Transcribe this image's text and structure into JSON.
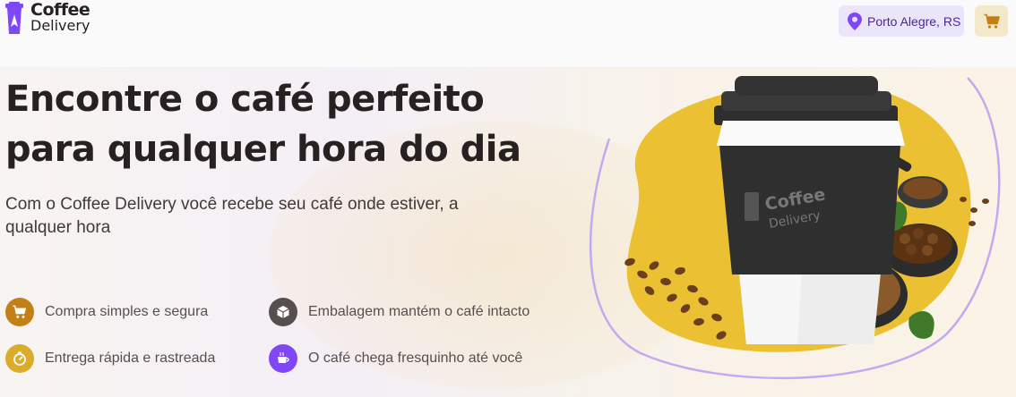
{
  "header": {
    "logo_line1": "Coffee",
    "logo_line2": "Delivery",
    "location": "Porto Alegre, RS",
    "icons": {
      "location": "map-pin-icon",
      "cart": "shopping-cart-icon"
    }
  },
  "hero": {
    "title_line1": "Encontre o café perfeito",
    "title_line2": "para qualquer hora do dia",
    "subtitle": "Com o Coffee Delivery você recebe seu café onde estiver, a qualquer hora",
    "features": [
      {
        "label": "Compra simples e segura",
        "icon": "shopping-cart-icon",
        "color": "#C47F17"
      },
      {
        "label": "Embalagem mantém o café intacto",
        "icon": "package-icon",
        "color": "#574F4D"
      },
      {
        "label": "Entrega rápida e rastreada",
        "icon": "timer-icon",
        "color": "#DBAC2C"
      },
      {
        "label": "O café chega fresquinho até você",
        "icon": "coffee-icon",
        "color": "#8047F8"
      }
    ],
    "cup_logo_line1": "Coffee",
    "cup_logo_line2": "Delivery"
  },
  "colors": {
    "purple": "#8047F8",
    "purple_light": "#EBE5F9",
    "yellow": "#DBAC2C",
    "yellow_dark": "#C47F17",
    "yellow_light": "#F1E9C9",
    "text_title": "#272221"
  }
}
